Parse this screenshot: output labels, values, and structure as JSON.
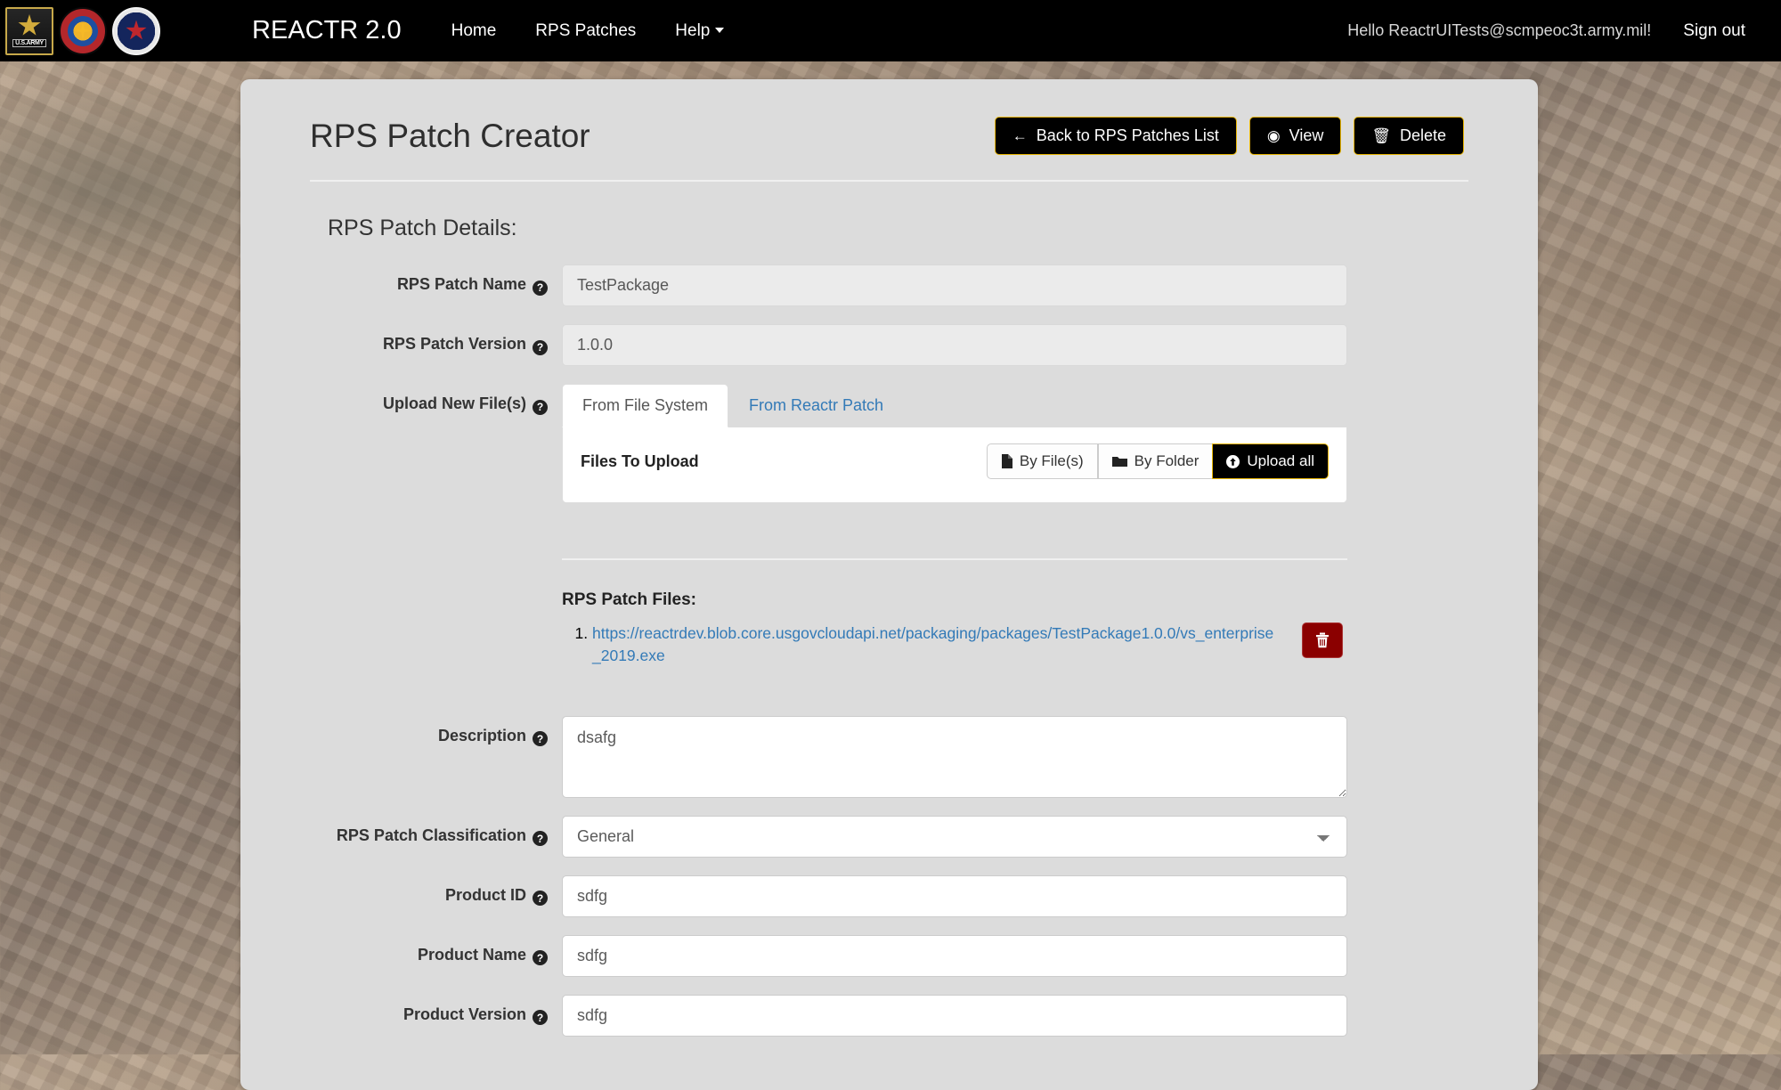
{
  "navbar": {
    "brand": "REACTR 2.0",
    "logos": [
      {
        "name": "us-army-logo",
        "label": "U.S.ARMY"
      },
      {
        "name": "peo-c3t-crest-logo",
        "label": ""
      },
      {
        "name": "army-seal-logo",
        "label": ""
      }
    ],
    "links": [
      {
        "name": "home",
        "label": "Home",
        "caret": false
      },
      {
        "name": "rps-patches",
        "label": "RPS Patches",
        "caret": false
      },
      {
        "name": "help",
        "label": "Help",
        "caret": true
      }
    ],
    "greeting": "Hello ReactrUITests@scmpeoc3t.army.mil!",
    "signout": "Sign out"
  },
  "page": {
    "title": "RPS Patch Creator",
    "header_buttons": [
      {
        "name": "back-to-rps-patches-list",
        "label": "Back to RPS Patches List",
        "icon": "arrow-left-icon",
        "glyph": "←"
      },
      {
        "name": "view",
        "label": "View",
        "icon": "eye-icon",
        "glyph": "◉"
      },
      {
        "name": "delete",
        "label": "Delete",
        "icon": "trash-icon",
        "glyph": "🗑"
      }
    ],
    "section_heading": "RPS Patch Details:"
  },
  "form": {
    "help_glyph": "?",
    "fields": {
      "patch_name": {
        "label": "RPS Patch Name",
        "value": "TestPackage",
        "disabled": true
      },
      "patch_version": {
        "label": "RPS Patch Version",
        "value": "1.0.0",
        "disabled": true
      },
      "upload_files": {
        "label": "Upload New File(s)"
      },
      "description": {
        "label": "Description",
        "value": "dsafg"
      },
      "classification": {
        "label": "RPS Patch Classification",
        "value": "General",
        "options": [
          "General"
        ]
      },
      "product_id": {
        "label": "Product ID",
        "value": "sdfg"
      },
      "product_name": {
        "label": "Product Name",
        "value": "sdfg"
      },
      "product_version": {
        "label": "Product Version",
        "value": "sdfg"
      }
    }
  },
  "upload_tabs": {
    "tabs": [
      {
        "name": "from-file-system",
        "label": "From File System",
        "active": true
      },
      {
        "name": "from-reactr-patch",
        "label": "From Reactr Patch",
        "active": false
      }
    ],
    "files_to_upload_label": "Files To Upload",
    "buttons": [
      {
        "name": "by-files",
        "label": "By File(s)",
        "icon": "file-icon",
        "glyph": "🗋"
      },
      {
        "name": "by-folder",
        "label": "By Folder",
        "icon": "folder-icon",
        "glyph": "📁"
      },
      {
        "name": "upload-all",
        "label": "Upload all",
        "icon": "upload-circle-icon",
        "glyph": "⬆"
      }
    ]
  },
  "patch_files": {
    "heading": "RPS Patch Files:",
    "items": [
      {
        "index": "1.",
        "url": "https://reactrdev.blob.core.usgovcloudapi.net/packaging/packages/TestPackage1.0.0/vs_enterprise_2019.exe",
        "delete_glyph": "🗑"
      }
    ]
  },
  "colors": {
    "nav_bg": "#000000",
    "panel_bg": "#dcdcdc",
    "accent_gold": "#e8b500",
    "link_blue": "#337ab7",
    "danger_red": "#8b0000"
  }
}
